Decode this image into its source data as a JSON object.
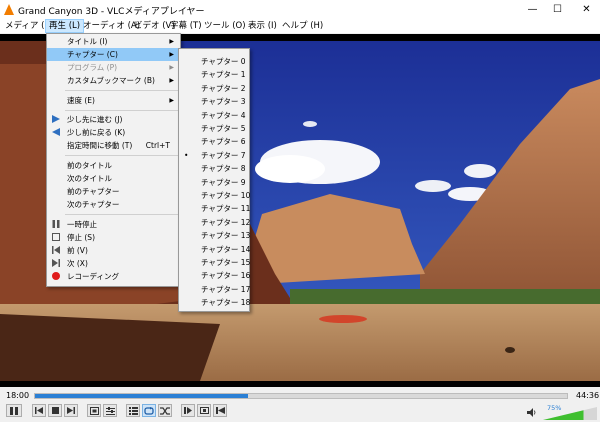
{
  "window": {
    "title": "Grand Canyon 3D - VLCメディアプレイヤー",
    "minimize": "—",
    "maximize": "☐",
    "close": "✕"
  },
  "menubar": [
    "メディア (M)",
    "再生 (L)",
    "オーディオ (A)",
    "ビデオ (V)",
    "字幕 (T)",
    "ツール (O)",
    "表示 (I)",
    "ヘルプ (H)"
  ],
  "playback_menu": {
    "title": "タイトル (I)",
    "chapter": "チャプター (C)",
    "program": "プログラム (P)",
    "bookmarks": "カスタムブックマーク (B)",
    "speed": "速度 (E)",
    "jump_forward": "少し先に進む (J)",
    "jump_back": "少し前に戻る (K)",
    "jump_time": "指定時間に移動 (T)",
    "jump_time_shortcut": "Ctrl+T",
    "prev_title": "前のタイトル",
    "next_title": "次のタイトル",
    "prev_chapter": "前のチャプター",
    "next_chapter": "次のチャプター",
    "pause": "一時停止",
    "stop": "停止 (S)",
    "previous": "前 (V)",
    "next": "次 (X)",
    "record": "レコーディング"
  },
  "chapters": [
    "チャプター 0",
    "チャプター 1",
    "チャプター 2",
    "チャプター 3",
    "チャプター 4",
    "チャプター 5",
    "チャプター 6",
    "チャプター 7",
    "チャプター 8",
    "チャプター 9",
    "チャプター 10",
    "チャプター 11",
    "チャプター 12",
    "チャプター 13",
    "チャプター 14",
    "チャプター 15",
    "チャプター 16",
    "チャプター 17",
    "チャプター 18"
  ],
  "selected_chapter_index": 7,
  "selected_mark": "•",
  "controls": {
    "elapsed": "18:00",
    "total": "44:36",
    "progress": 0.4,
    "volume_label": "75%",
    "volume": 0.75
  },
  "colors": {
    "accent": "#2a7fd4",
    "menu_highlight": "#91c9f7",
    "record": "#e01b1b"
  }
}
